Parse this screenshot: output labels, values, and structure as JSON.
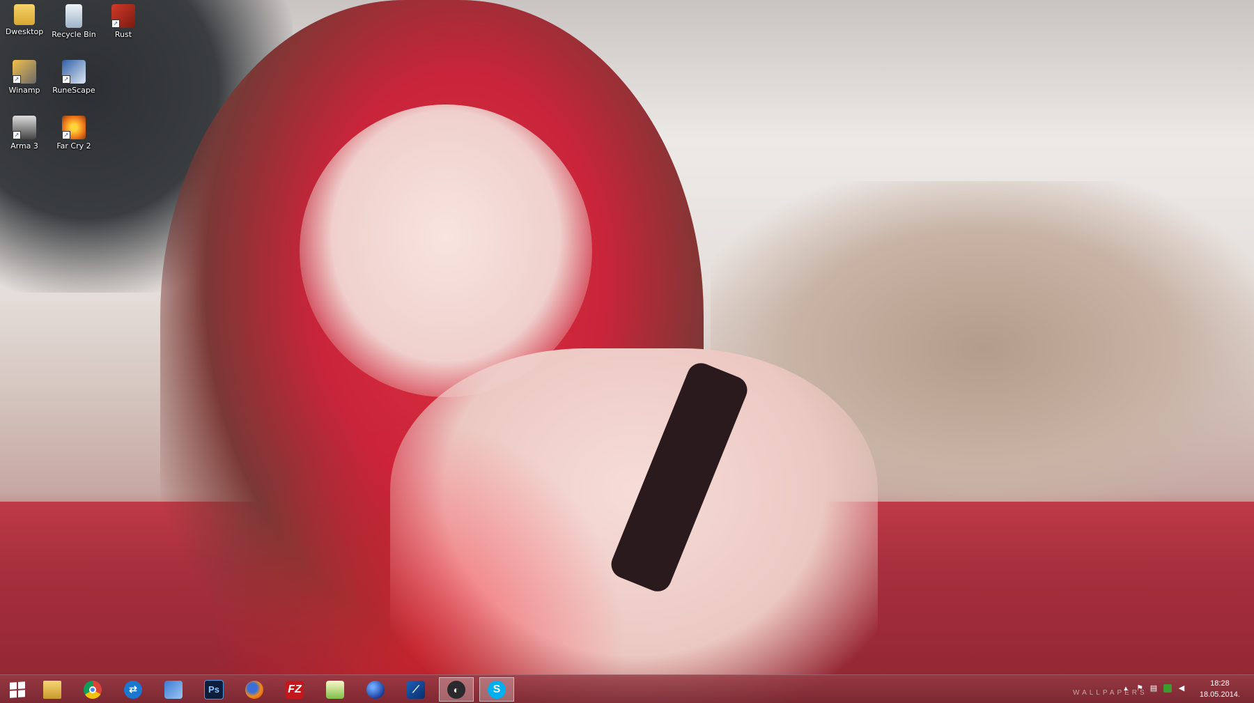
{
  "desktop": {
    "icons": [
      {
        "label": "Dwesktop",
        "icon": "folder-icon",
        "shortcut": false
      },
      {
        "label": "Recycle Bin",
        "icon": "recycle-bin-icon",
        "shortcut": false
      },
      {
        "label": "Rust",
        "icon": "rust-game-icon",
        "shortcut": true
      },
      {
        "label": "Winamp",
        "icon": "winamp-icon",
        "shortcut": true
      },
      {
        "label": "RuneScape",
        "icon": "runescape-icon",
        "shortcut": true
      },
      {
        "label": "Arma 3",
        "icon": "arma-3-icon",
        "shortcut": true
      },
      {
        "label": "Far Cry 2",
        "icon": "far-cry-2-icon",
        "shortcut": true
      }
    ]
  },
  "taskbar": {
    "pinned": [
      {
        "icon": "windows-start-icon",
        "text": ""
      },
      {
        "icon": "file-explorer-icon",
        "text": ""
      },
      {
        "icon": "chrome-icon",
        "text": ""
      },
      {
        "icon": "teamviewer-icon",
        "text": ""
      },
      {
        "icon": "network-icon",
        "text": ""
      },
      {
        "icon": "photoshop-icon",
        "text": "Ps"
      },
      {
        "icon": "firefox-icon",
        "text": ""
      },
      {
        "icon": "filezilla-icon",
        "text": "FZ"
      },
      {
        "icon": "notepad-plus-plus-icon",
        "text": ""
      },
      {
        "icon": "globe-icon",
        "text": ""
      },
      {
        "icon": "tool-icon",
        "text": ""
      },
      {
        "icon": "steam-icon",
        "text": "",
        "active": true
      },
      {
        "icon": "skype-icon",
        "text": "S",
        "active": true
      }
    ],
    "tray": {
      "watermark": "WALLPAPERS",
      "icons": [
        "chevron-up-icon",
        "flag-icon",
        "network-status-icon",
        "nvidia-icon",
        "volume-icon"
      ],
      "time": "18:28",
      "date": "18.05.2014."
    }
  }
}
